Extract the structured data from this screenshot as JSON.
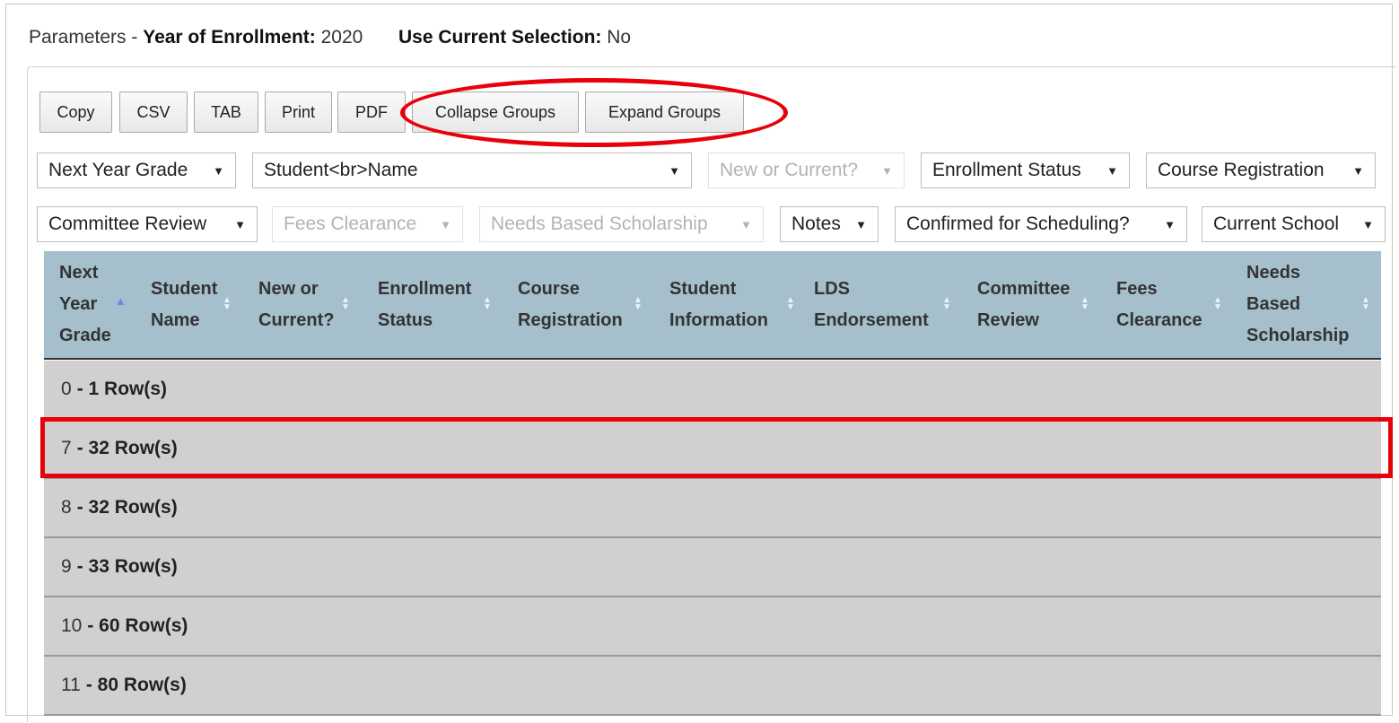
{
  "parameters": {
    "prefix": "Parameters -",
    "year_label": "Year of Enrollment:",
    "year_value": "2020",
    "current_label": "Use Current Selection:",
    "current_value": "No"
  },
  "buttons": {
    "copy": "Copy",
    "csv": "CSV",
    "tab": "TAB",
    "print": "Print",
    "pdf": "PDF",
    "collapse": "Collapse Groups",
    "expand": "Expand Groups"
  },
  "filters": {
    "next_year_grade": "Next Year Grade",
    "student_name": "Student<br>Name",
    "new_or_current": "New or Current?",
    "enrollment_status": "Enrollment Status",
    "course_registration": "Course Registration",
    "committee_review": "Committee Review",
    "fees_clearance": "Fees Clearance",
    "needs_based_scholarship": "Needs Based Scholarship",
    "notes": "Notes",
    "confirmed_for_scheduling": "Confirmed for Scheduling?",
    "current_school": "Current School",
    "arrow": "▼"
  },
  "columns": {
    "next_year_grade": "Next\nYear\nGrade",
    "student_name": "Student\nName",
    "new_or_current": "New or\nCurrent?",
    "enrollment_status": "Enrollment\nStatus",
    "course_registration": "Course\nRegistration",
    "student_information": "Student\nInformation",
    "lds_endorsement": "LDS\nEndorsement",
    "committee_review": "Committee\nReview",
    "fees_clearance": "Fees\nClearance",
    "needs_based_scholarship": "Needs\nBased\nScholarship"
  },
  "groups": [
    {
      "key": "0",
      "count": "- 1 Row(s)"
    },
    {
      "key": "7",
      "count": "- 32 Row(s)"
    },
    {
      "key": "8",
      "count": "- 32 Row(s)"
    },
    {
      "key": "9",
      "count": "- 33 Row(s)"
    },
    {
      "key": "10",
      "count": "- 60 Row(s)"
    },
    {
      "key": "11",
      "count": "- 80 Row(s)"
    }
  ],
  "colors": {
    "header_bg": "#a6bfcc",
    "group_bg": "#d2cfd0",
    "highlight": "#e8000a",
    "sort_active": "#6e86e8"
  }
}
